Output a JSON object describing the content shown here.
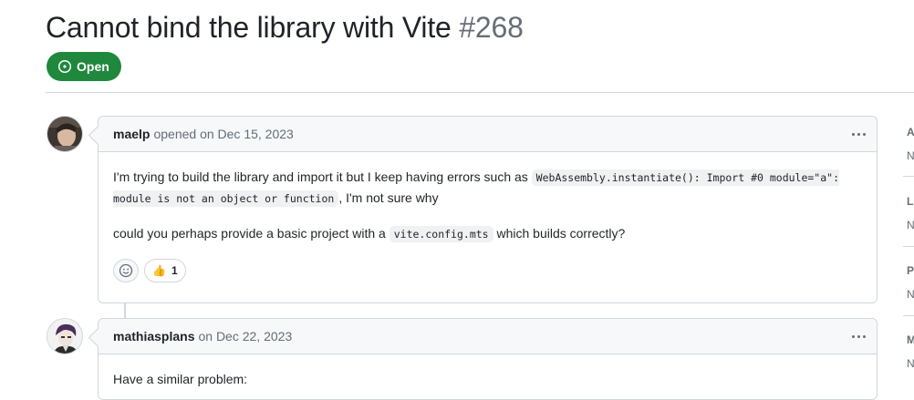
{
  "issue": {
    "title": "Cannot bind the library with Vite",
    "number": "#268",
    "state": "Open"
  },
  "comments": [
    {
      "author": "maelp",
      "meta": "opened on Dec 15, 2023",
      "body": {
        "p1_text": "I'm trying to build the library and import it but I keep having errors such as ",
        "p1_code": "WebAssembly.instantiate(): Import #0 module=\"a\": module is not an object or function",
        "p1_tail": ", I'm not sure why",
        "p2_text": "could you perhaps provide a basic project with a ",
        "p2_code": "vite.config.mts",
        "p2_tail": " which builds correctly?"
      },
      "reactions": [
        {
          "emoji": "👍",
          "count": "1"
        }
      ]
    },
    {
      "author": "mathiasplans",
      "meta": "on Dec 22, 2023",
      "body": {
        "p1_text": "Have a similar problem:"
      }
    }
  ],
  "sidebar": [
    {
      "label": "A",
      "value": "N"
    },
    {
      "label": "La",
      "value": "N"
    },
    {
      "label": "P",
      "value": "N"
    },
    {
      "label": "M",
      "value": "N"
    }
  ],
  "icons": {
    "state": "issue-opened-icon",
    "add_reaction": "smiley-icon",
    "menu": "kebab-horizontal-icon"
  },
  "colors": {
    "open": "#1f883d",
    "border": "#d0d7de",
    "muted": "#656d76"
  }
}
